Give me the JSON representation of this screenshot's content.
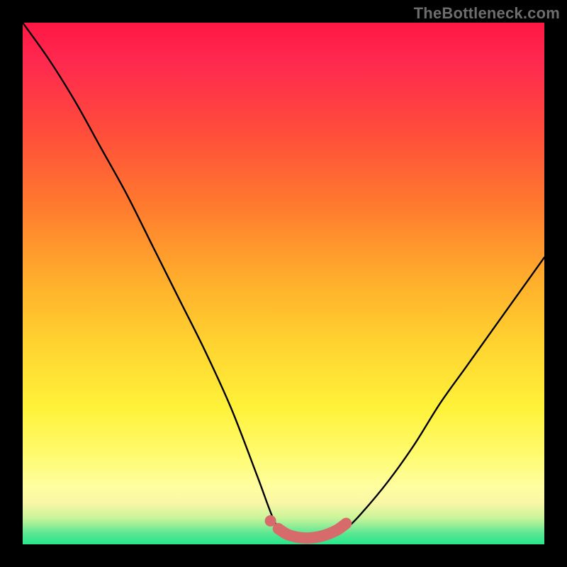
{
  "watermark": "TheBottleneck.com",
  "colors": {
    "page_bg": "#000000",
    "gradient_top": "#ff1744",
    "gradient_mid1": "#ff7a2e",
    "gradient_mid2": "#ffd430",
    "gradient_mid3": "#fff23a",
    "gradient_bottom": "#26e78c",
    "curve": "#000000",
    "marker": "#d76b6b"
  },
  "chart_data": {
    "type": "line",
    "title": "",
    "xlabel": "",
    "ylabel": "",
    "xlim": [
      0,
      100
    ],
    "ylim": [
      0,
      100
    ],
    "note": "V-shaped bottleneck curve. y ≈ 100 at x=0, drops to ~0 near x≈48–60, rises toward ~55 at x=100. Values below are read off the plot.",
    "series": [
      {
        "name": "bottleneck_curve",
        "x": [
          0,
          5,
          10,
          15,
          20,
          25,
          30,
          35,
          40,
          45,
          48,
          50,
          54,
          58,
          60,
          62,
          65,
          70,
          75,
          80,
          85,
          90,
          95,
          100
        ],
        "y": [
          100,
          93,
          85,
          76,
          67,
          57,
          47,
          37,
          26,
          13,
          5,
          2,
          1,
          1,
          2,
          3,
          6,
          12,
          19,
          27,
          34,
          41,
          48,
          55
        ]
      }
    ],
    "markers": {
      "name": "highlight_segment",
      "note": "Short thick coral segment near the trough plus one dot just to its left.",
      "dot": {
        "x": 47.5,
        "y": 4.5
      },
      "thick_path": [
        {
          "x": 49,
          "y": 3.0
        },
        {
          "x": 51,
          "y": 1.8
        },
        {
          "x": 54,
          "y": 1.2
        },
        {
          "x": 57,
          "y": 1.5
        },
        {
          "x": 60,
          "y": 2.6
        },
        {
          "x": 62,
          "y": 4.0
        }
      ]
    }
  }
}
